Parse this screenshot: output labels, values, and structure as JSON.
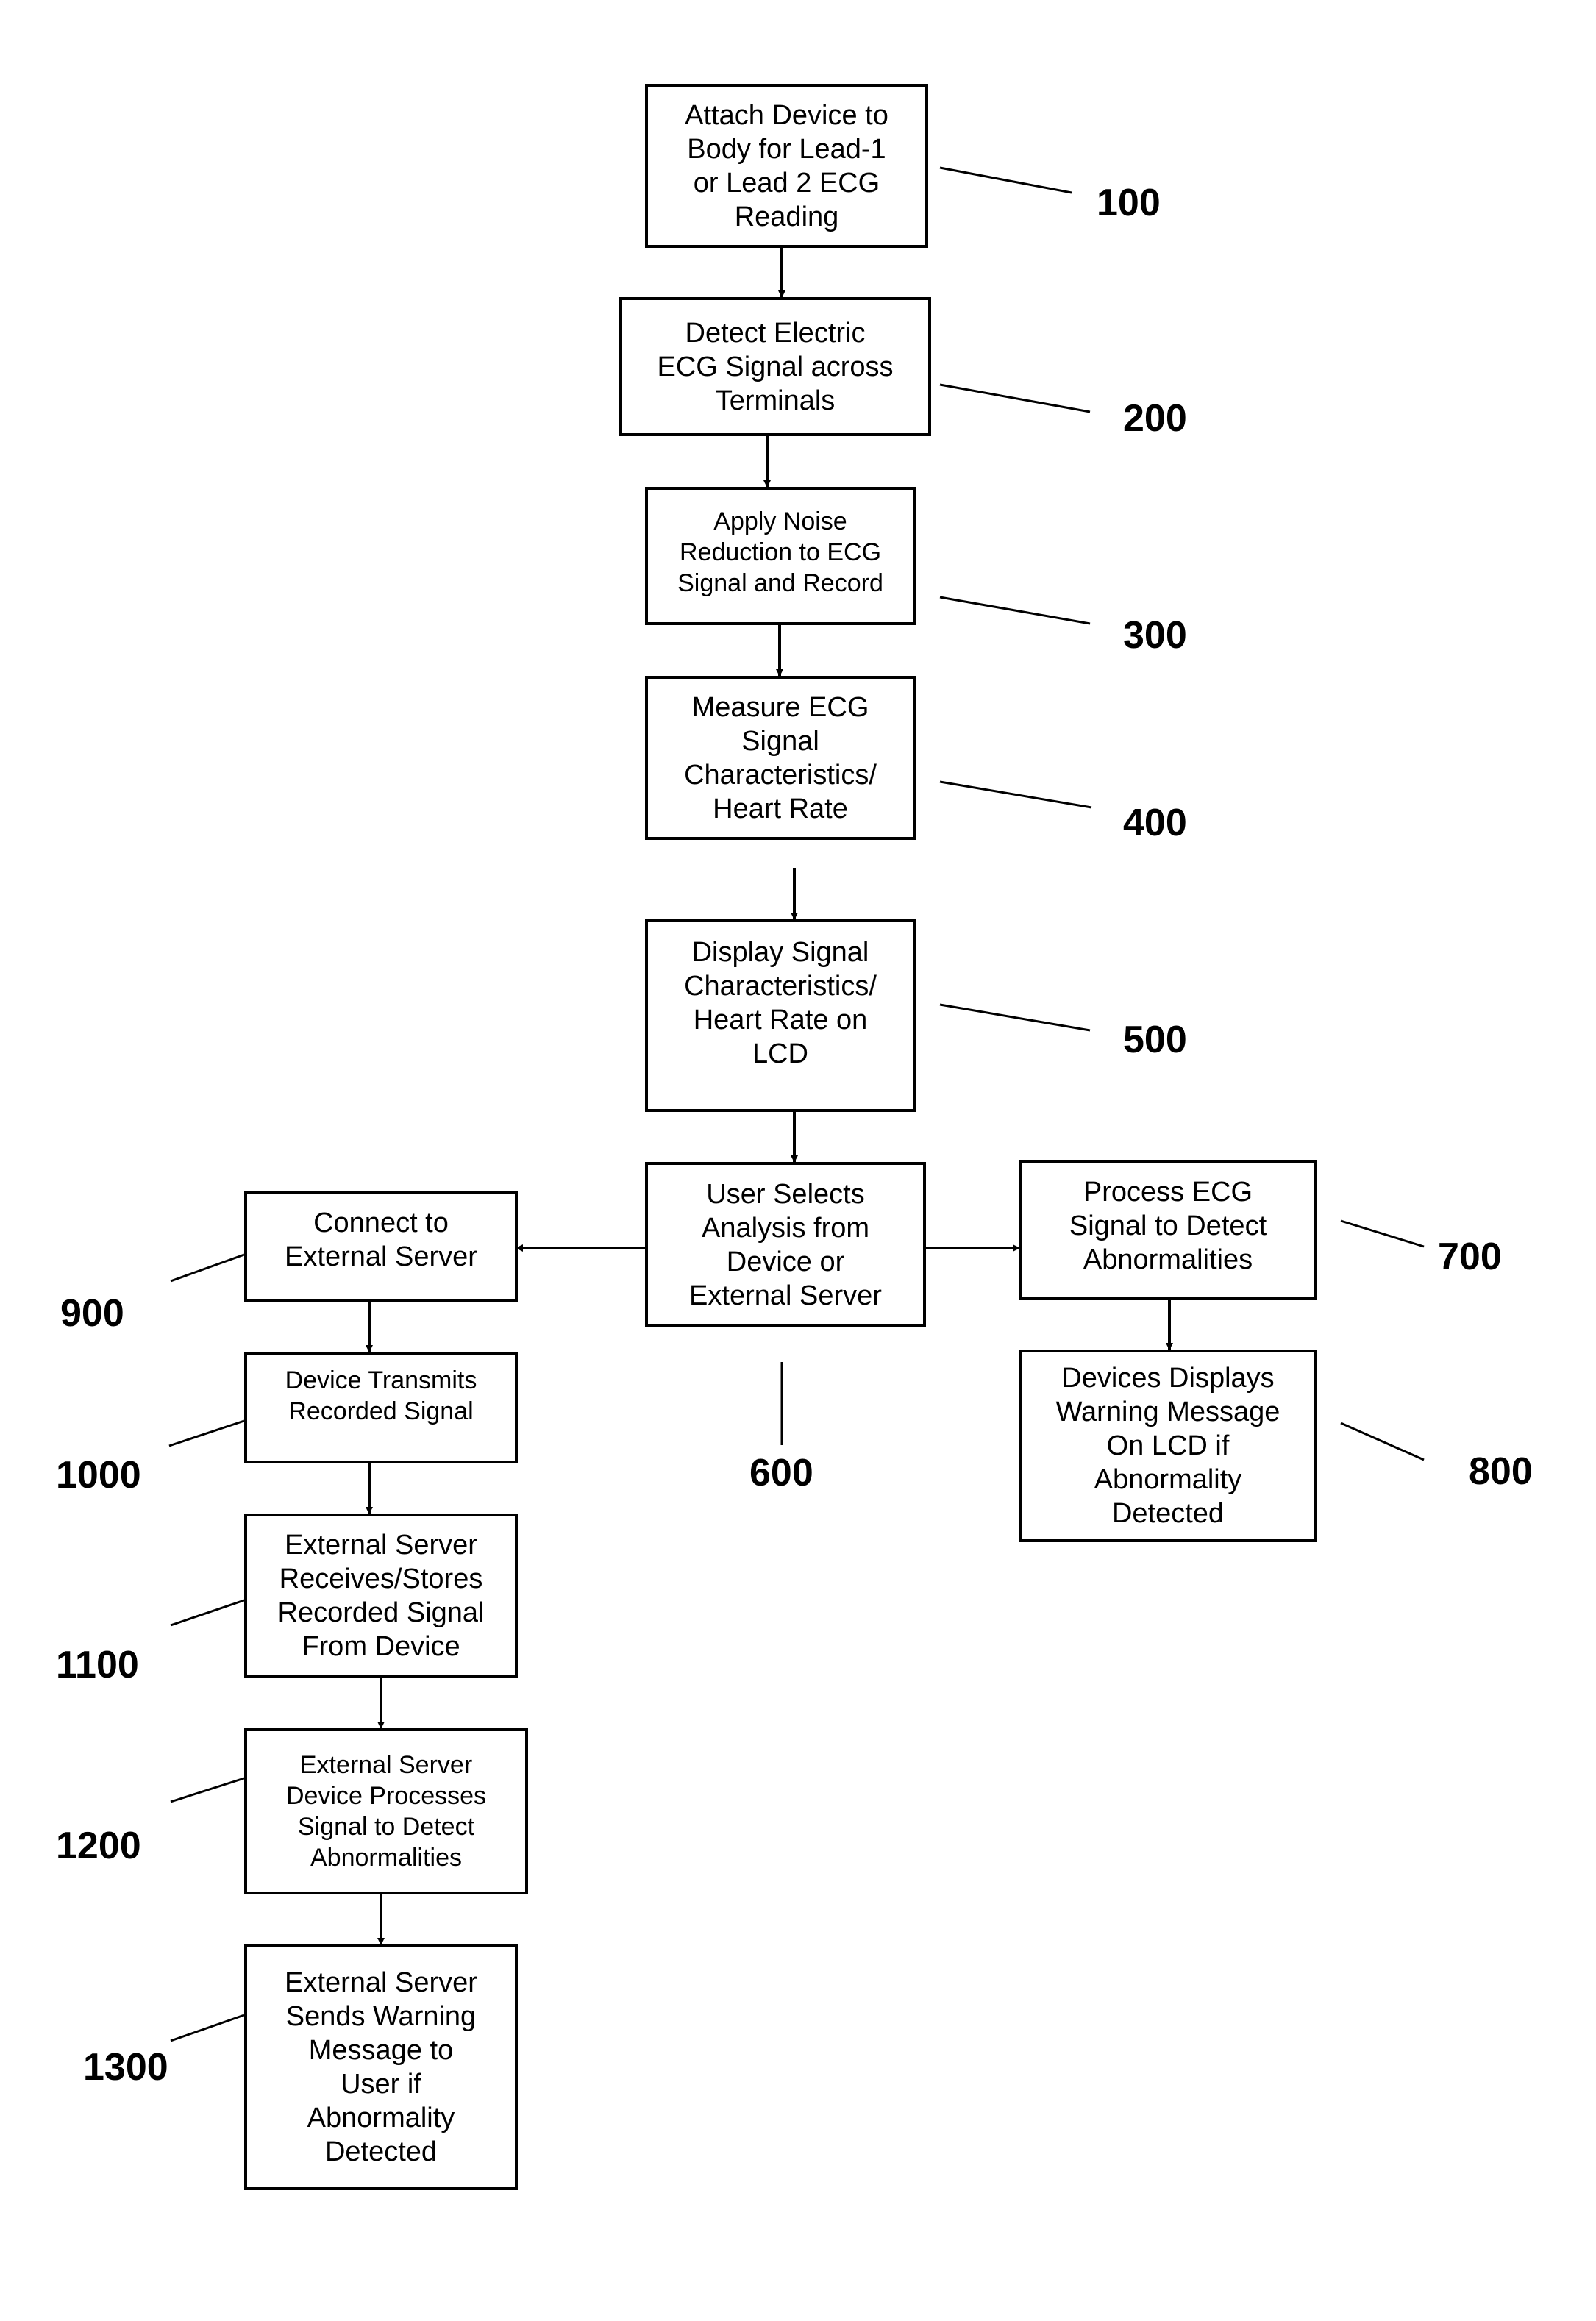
{
  "figure": {
    "steps": [
      {
        "id": "100",
        "lines": [
          "Attach Device to",
          "Body for Lead-1",
          "or Lead 2 ECG",
          "Reading"
        ]
      },
      {
        "id": "200",
        "lines": [
          "Detect Electric",
          "ECG Signal across",
          "Terminals"
        ]
      },
      {
        "id": "300",
        "lines": [
          "Apply Noise",
          "Reduction to ECG",
          "Signal and Record"
        ]
      },
      {
        "id": "400",
        "lines": [
          "Measure ECG",
          "Signal",
          "Characteristics/",
          "Heart Rate"
        ]
      },
      {
        "id": "500",
        "lines": [
          "Display Signal",
          "Characteristics/",
          "Heart Rate on",
          "LCD"
        ]
      },
      {
        "id": "600",
        "lines": [
          "User Selects",
          "Analysis from",
          "Device or",
          "External Server"
        ]
      },
      {
        "id": "700",
        "lines": [
          "Process ECG",
          "Signal to Detect",
          "Abnormalities"
        ]
      },
      {
        "id": "800",
        "lines": [
          "Devices Displays",
          "Warning Message",
          "On LCD if",
          "Abnormality",
          "Detected"
        ]
      },
      {
        "id": "900",
        "lines": [
          "Connect to",
          "External Server"
        ]
      },
      {
        "id": "1000",
        "lines": [
          "Device Transmits",
          "Recorded Signal"
        ]
      },
      {
        "id": "1100",
        "lines": [
          "External Server",
          "Receives/Stores",
          "Recorded Signal",
          "From Device"
        ]
      },
      {
        "id": "1200",
        "lines": [
          "External Server",
          "Device Processes",
          "Signal to Detect",
          "Abnormalities"
        ]
      },
      {
        "id": "1300",
        "lines": [
          "External Server",
          "Sends Warning",
          "Message to",
          "User if",
          "Abnormality",
          "Detected"
        ]
      }
    ],
    "reference_labels": [
      "100",
      "200",
      "300",
      "400",
      "500",
      "600",
      "700",
      "800",
      "900",
      "1000",
      "1100",
      "1200",
      "1300"
    ],
    "flows": [
      {
        "from": "100",
        "to": "200"
      },
      {
        "from": "200",
        "to": "300"
      },
      {
        "from": "300",
        "to": "400"
      },
      {
        "from": "400",
        "to": "500"
      },
      {
        "from": "500",
        "to": "600"
      },
      {
        "from": "600",
        "to": "700"
      },
      {
        "from": "600",
        "to": "900"
      },
      {
        "from": "700",
        "to": "800"
      },
      {
        "from": "900",
        "to": "1000"
      },
      {
        "from": "1000",
        "to": "1100"
      },
      {
        "from": "1100",
        "to": "1200"
      },
      {
        "from": "1200",
        "to": "1300"
      }
    ]
  }
}
